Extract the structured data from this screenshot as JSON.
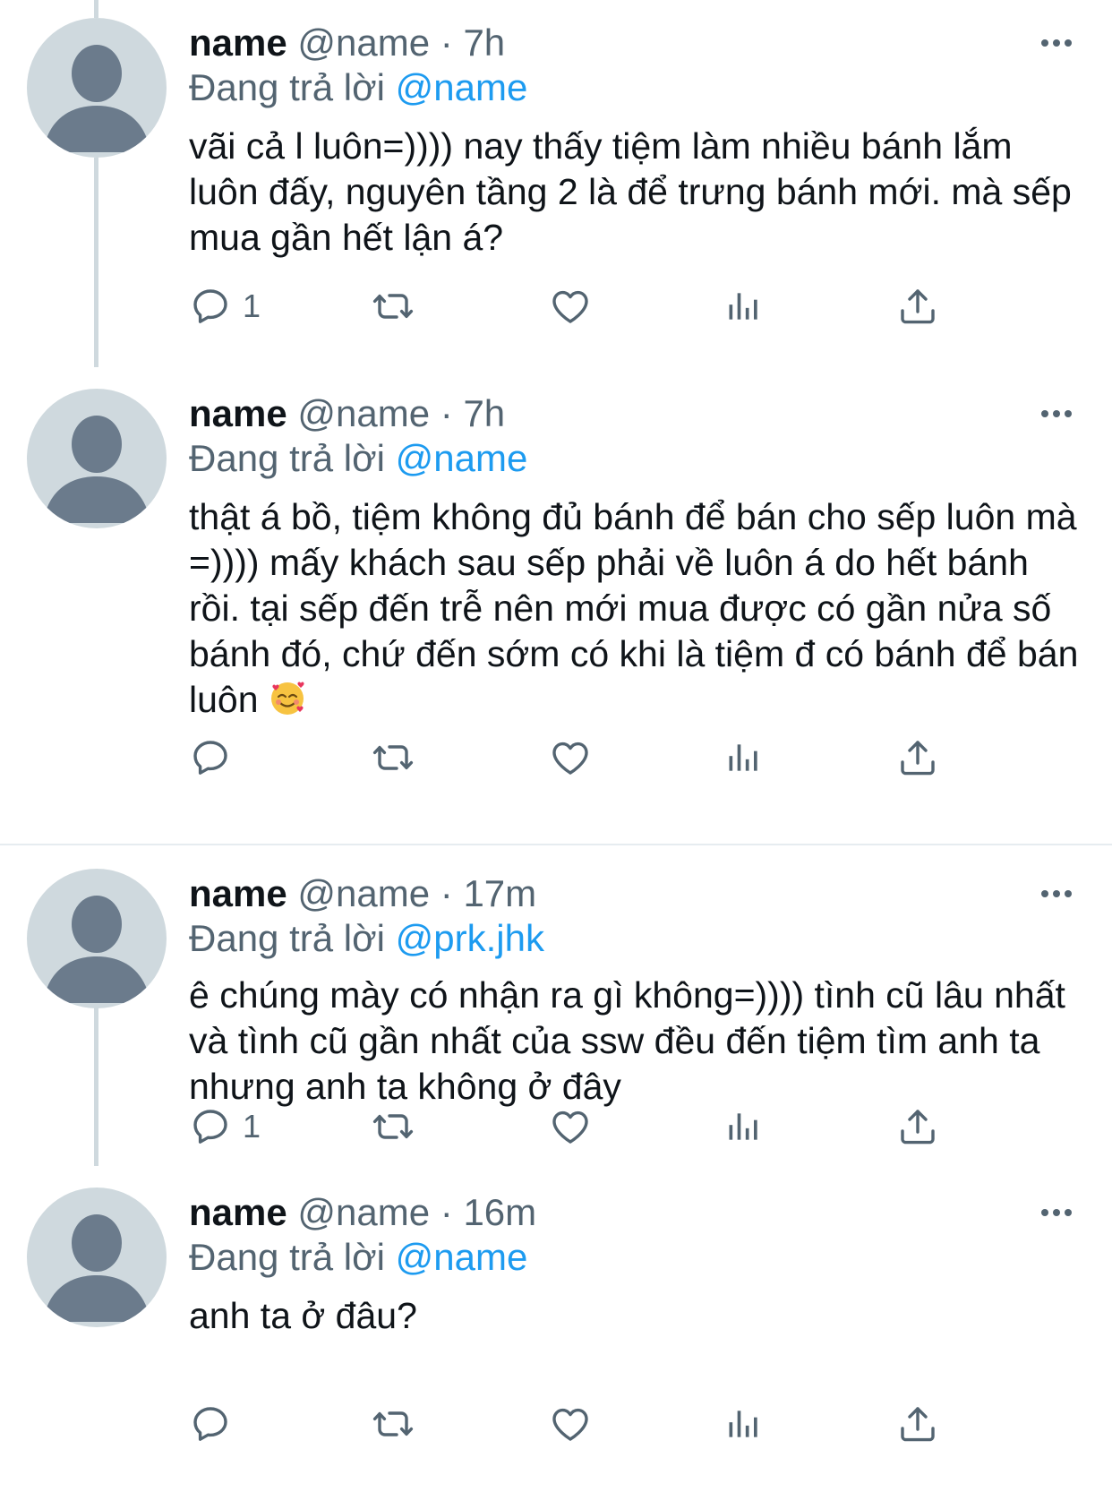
{
  "tweets": [
    {
      "display_name": "name",
      "handle": "@name",
      "sep": "·",
      "time": "7h",
      "reply_prefix": "Đang trả lời",
      "reply_to": "@name",
      "text": "vãi cả l luôn=)))) nay thấy tiệm làm nhiều bánh lắm luôn đấy, nguyên tầng 2 là để trưng bánh mới. mà sếp mua gần hết lận á?",
      "reply_count": "1"
    },
    {
      "display_name": "name",
      "handle": "@name",
      "sep": "·",
      "time": "7h",
      "reply_prefix": "Đang trả lời",
      "reply_to": "@name",
      "text": "thật á bồ, tiệm không đủ bánh để bán cho sếp luôn mà =)))) mấy khách sau sếp phải về luôn á do hết bánh rồi. tại sếp đến trễ nên mới mua được có gần nửa số bánh đó, chứ đến sớm có khi là tiệm đ có bánh để bán luôn",
      "emoji": "smiling-face-with-hearts",
      "reply_count": ""
    },
    {
      "display_name": "name",
      "handle": "@name",
      "sep": "·",
      "time": "17m",
      "reply_prefix": "Đang trả lời",
      "reply_to": "@prk.jhk",
      "text": "ê chúng mày có nhận ra gì không=)))) tình cũ lâu nhất và tình cũ gần nhất của ssw đều đến tiệm tìm anh ta nhưng anh ta không ở đây",
      "reply_count": "1"
    },
    {
      "display_name": "name",
      "handle": "@name",
      "sep": "·",
      "time": "16m",
      "reply_prefix": "Đang trả lời",
      "reply_to": "@name",
      "text": "anh ta ở đâu?",
      "reply_count": ""
    }
  ],
  "colors": {
    "text": "#0f1419",
    "secondary": "#536471",
    "link": "#1d9bf0",
    "avatar_bg": "#cfd9de",
    "avatar_figure": "#6b7b8c",
    "thread_line": "#cfd9de",
    "divider": "#e6ecf0"
  },
  "icons": [
    "reply-icon",
    "retweet-icon",
    "like-icon",
    "views-icon",
    "share-icon",
    "more-icon",
    "default-avatar-icon"
  ]
}
